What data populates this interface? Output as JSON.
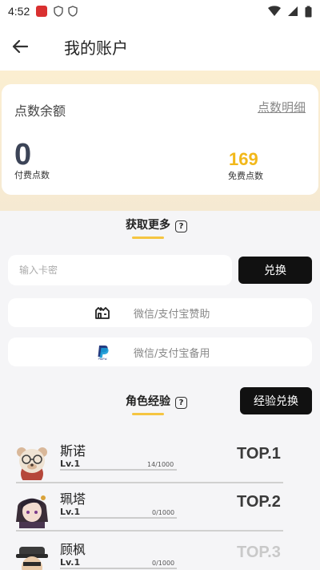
{
  "status_bar": {
    "time": "4:52"
  },
  "header": {
    "title": "我的账户"
  },
  "points": {
    "label": "点数余额",
    "detail_link": "点数明细",
    "paid_value": "0",
    "paid_label": "付费点数",
    "free_value": "169",
    "free_label": "免费点数"
  },
  "get_more": {
    "title": "获取更多"
  },
  "redeem": {
    "placeholder": "输入卡密",
    "button": "兑换"
  },
  "payments": [
    {
      "label": "微信/支付宝赞助",
      "icon": "mianbaoduo-icon"
    },
    {
      "label": "微信/支付宝备用",
      "icon": "paypal-icon"
    }
  ],
  "experience": {
    "title": "角色经验",
    "button": "经验兑换"
  },
  "roles": [
    {
      "name": "斯诺",
      "level": "Lv.1",
      "progress": "14/1000",
      "rank": "TOP.1"
    },
    {
      "name": "珮塔",
      "level": "Lv.1",
      "progress": "0/1000",
      "rank": "TOP.2"
    },
    {
      "name": "顾枫",
      "level": "Lv.1",
      "progress": "0/1000",
      "rank": "TOP.3"
    }
  ],
  "colors": {
    "accent": "#f5c542",
    "free_points": "#f2b81a",
    "button_bg": "#111111",
    "header_band": "#fbeed1"
  }
}
